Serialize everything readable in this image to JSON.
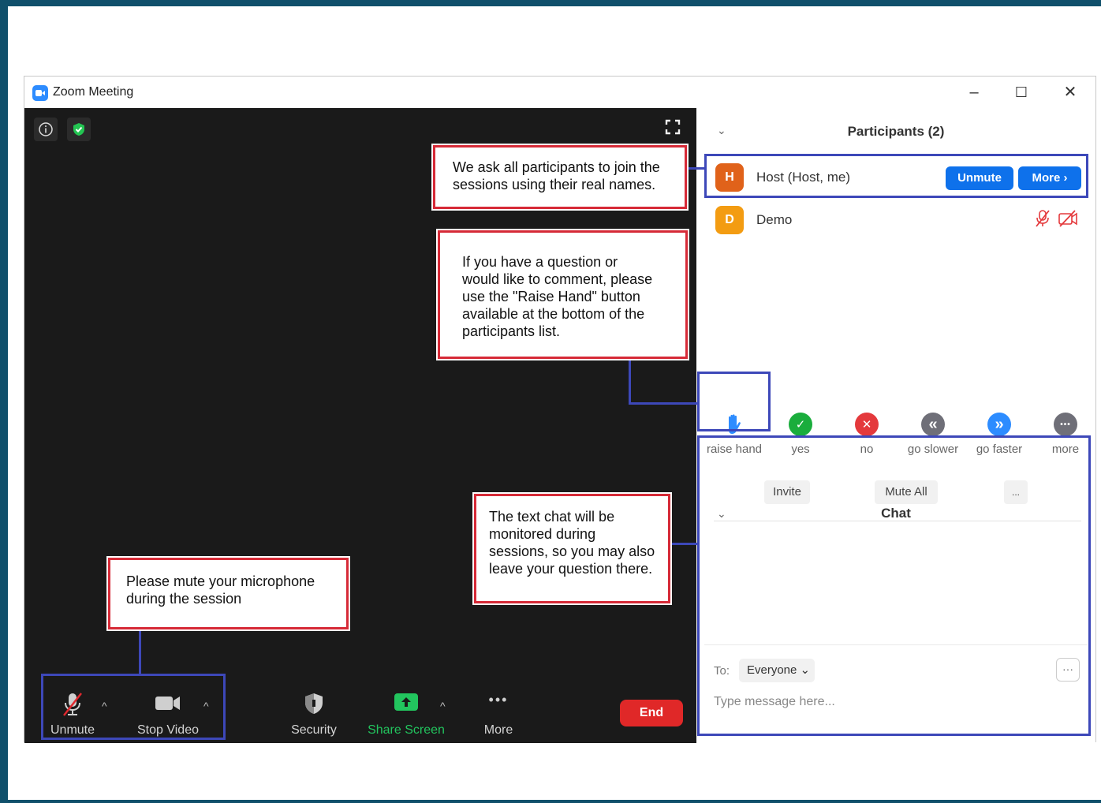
{
  "window": {
    "title": "Zoom Meeting",
    "minimize": "–",
    "maximize": "☐",
    "close": "✕"
  },
  "toolbar": {
    "unmute_label": "Unmute",
    "stop_video_label": "Stop Video",
    "security_label": "Security",
    "share_screen_label": "Share Screen",
    "more_label": "More",
    "end_label": "End",
    "caret": "^",
    "more_dots": "•••"
  },
  "participants": {
    "title": "Participants (2)",
    "collapse": "⌄",
    "items": [
      {
        "initial": "H",
        "name": "Host (Host, me)",
        "color": "#e0621a"
      },
      {
        "initial": "D",
        "name": "Demo",
        "color": "#f39c12"
      }
    ],
    "unmute_label": "Unmute",
    "more_label": "More ›"
  },
  "reactions": [
    {
      "label": "raise hand",
      "icon": "raise-hand-icon"
    },
    {
      "label": "yes",
      "icon": "check-icon",
      "glyph": "✓",
      "color": "#1aad3c"
    },
    {
      "label": "no",
      "icon": "x-icon",
      "glyph": "✕",
      "color": "#e4393c"
    },
    {
      "label": "go slower",
      "icon": "rewind-icon",
      "glyph": "«",
      "color": "#6f6f78"
    },
    {
      "label": "go faster",
      "icon": "fast-forward-icon",
      "glyph": "»",
      "color": "#2d8cff"
    },
    {
      "label": "more",
      "icon": "more-icon",
      "glyph": "•••",
      "color": "#6f6f78"
    }
  ],
  "panel_buttons": {
    "invite": "Invite",
    "mute_all": "Mute All",
    "ellipsis": "..."
  },
  "chat": {
    "title": "Chat",
    "collapse": "⌄",
    "to_label": "To:",
    "recipient": "Everyone ⌄",
    "more": "···",
    "placeholder": "Type message here..."
  },
  "callouts": {
    "real_names": "We ask all participants to join the\nsessions using their real names.",
    "raise_hand": "If you have a question or\nwould like to comment, please\nuse the \"Raise Hand\" button\navailable at the bottom of the\nparticipants list.",
    "text_chat": "The text chat will be\nmonitored during\nsessions, so you may also\nleave your question there.",
    "mute_mic": "Please mute your microphone\nduring the session"
  },
  "colors": {
    "frame": "#10506b",
    "callout_border": "#d62a37",
    "highlight_border": "#3d48b9",
    "zoom_blue": "#0e71eb",
    "share_green": "#22c55e",
    "end_red": "#e02828"
  }
}
